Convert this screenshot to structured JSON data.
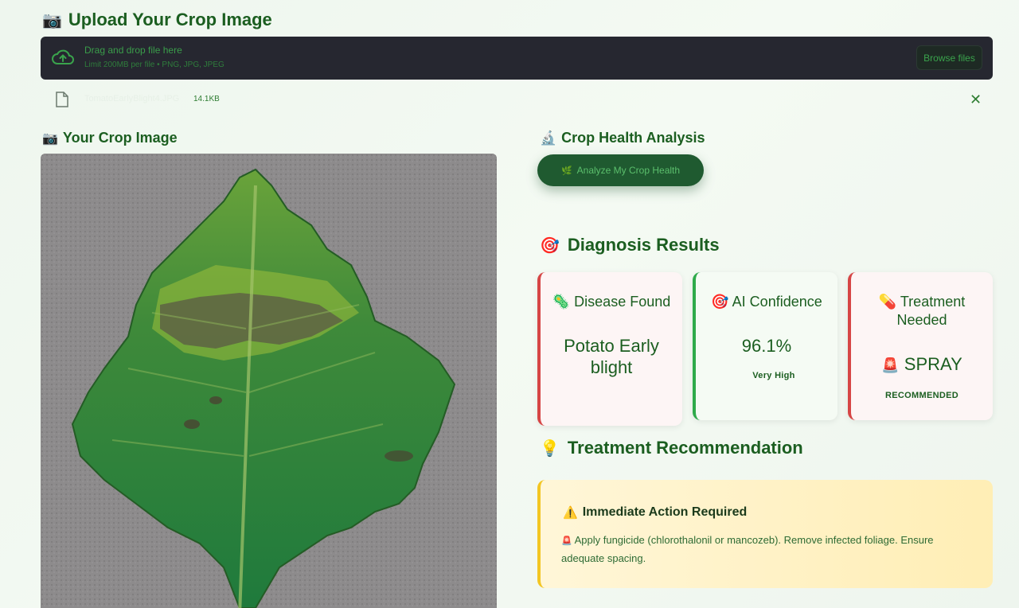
{
  "upload": {
    "heading": "Upload Your Crop Image",
    "drop_title": "Drag and drop file here",
    "drop_limit": "Limit 200MB per file • PNG, JPG, JPEG",
    "browse_label": "Browse files"
  },
  "file": {
    "name": "TomatoEarlyBlight4.JPG",
    "size": "14.1KB"
  },
  "image_section": {
    "heading": "Your Crop Image"
  },
  "analysis": {
    "heading": "Crop Health Analysis",
    "button_label": "Analyze My Crop Health"
  },
  "diagnosis": {
    "heading": "Diagnosis Results",
    "cards": [
      {
        "title": "Disease Found",
        "value": "Potato Early blight",
        "sub": "",
        "icon": "microbe-icon",
        "accent": "#d64545"
      },
      {
        "title": "AI Confidence",
        "value": "96.1%",
        "sub": "Very High",
        "icon": "target-icon",
        "accent": "#2eaa4a"
      },
      {
        "title": "Treatment Needed",
        "value": "SPRAY",
        "sub": "RECOMMENDED",
        "icon": "pill-icon",
        "accent": "#d64545"
      }
    ]
  },
  "treatment": {
    "heading": "Treatment Recommendation",
    "box_title": "Immediate Action Required",
    "box_text": "Apply fungicide (chlorothalonil or mancozeb). Remove infected foliage. Ensure adequate spacing."
  },
  "colors": {
    "primary_text": "#1b5e20",
    "dropzone_bg": "#262730",
    "alert_red": "#d64545",
    "success_green": "#2eaa4a",
    "warning_yellow": "#f3c623"
  }
}
